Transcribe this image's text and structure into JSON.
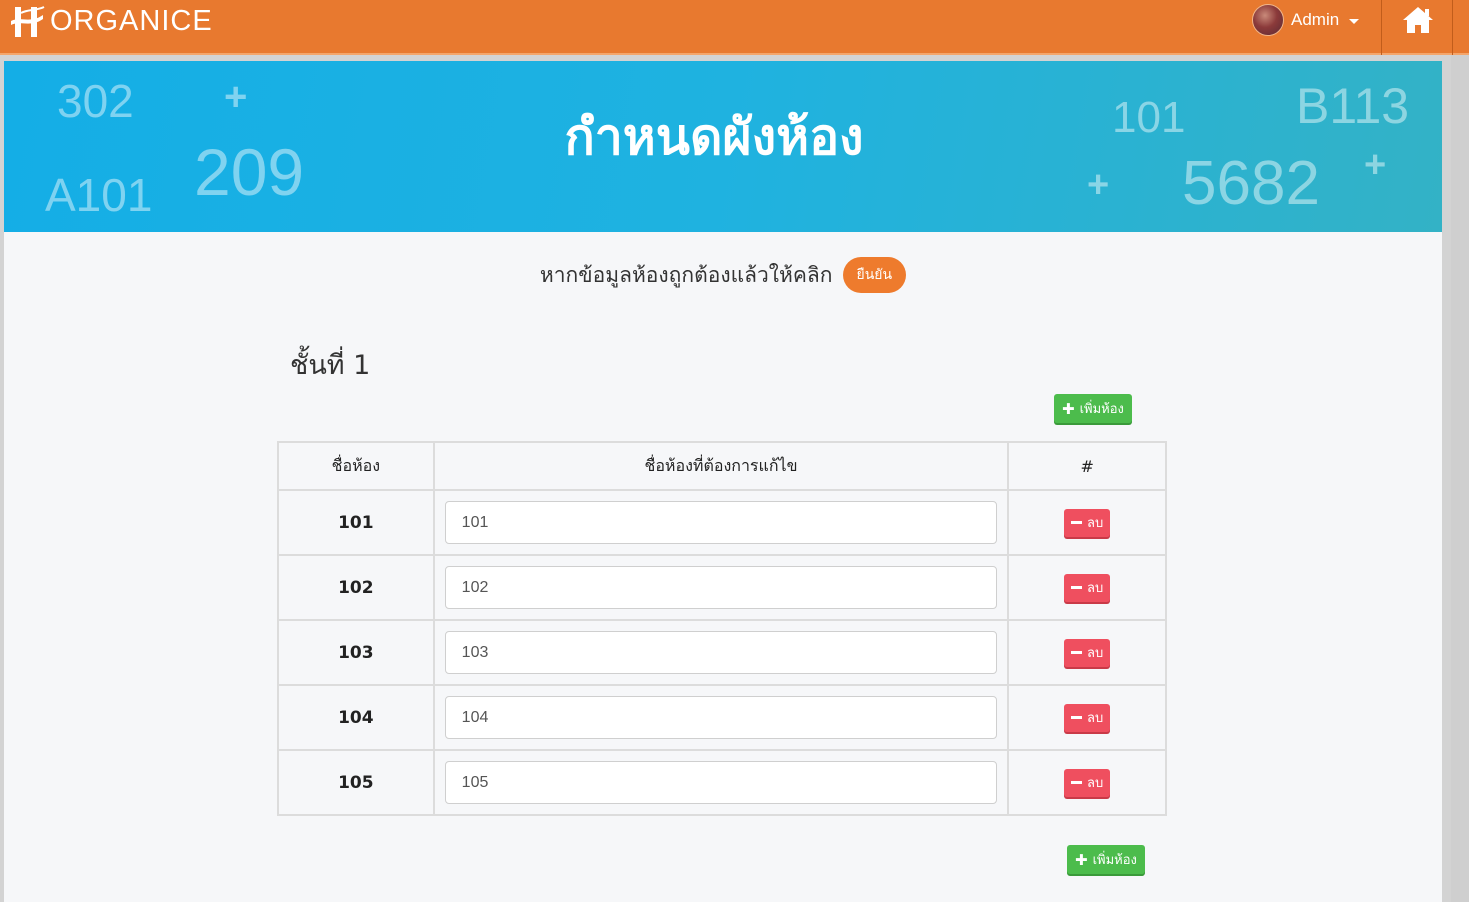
{
  "navbar": {
    "brand": "ORGANICE",
    "user": "Admin"
  },
  "hero": {
    "title": "กำหนดผังห้อง",
    "decor": [
      "302",
      "+",
      "A101",
      "209",
      "101",
      "B113",
      "+",
      "5682",
      "+"
    ]
  },
  "notice": {
    "text": "หากข้อมูลห้องถูกต้องแล้วให้คลิก",
    "confirm_label": "ยืนยัน"
  },
  "floor": {
    "title": "ชั้นที่ 1",
    "add_room_label": "เพิ่มห้อง",
    "columns": [
      "ชื่อห้อง",
      "ชื่อห้องที่ต้องการแก้ไข",
      "#"
    ],
    "delete_label": "ลบ",
    "rooms": [
      {
        "name": "101",
        "value": "101"
      },
      {
        "name": "102",
        "value": "102"
      },
      {
        "name": "103",
        "value": "103"
      },
      {
        "name": "104",
        "value": "104"
      },
      {
        "name": "105",
        "value": "105"
      }
    ]
  },
  "colors": {
    "navbar": "#e8792f",
    "hero_start": "#14aee6",
    "hero_end": "#33b2c6",
    "confirm": "#ee7b2d",
    "add": "#4cbc4c",
    "delete": "#ef4f5f"
  },
  "icons": {
    "brand": "hotel-h-logo-icon",
    "home": "home-icon",
    "add": "plus-icon",
    "delete": "minus-icon"
  }
}
